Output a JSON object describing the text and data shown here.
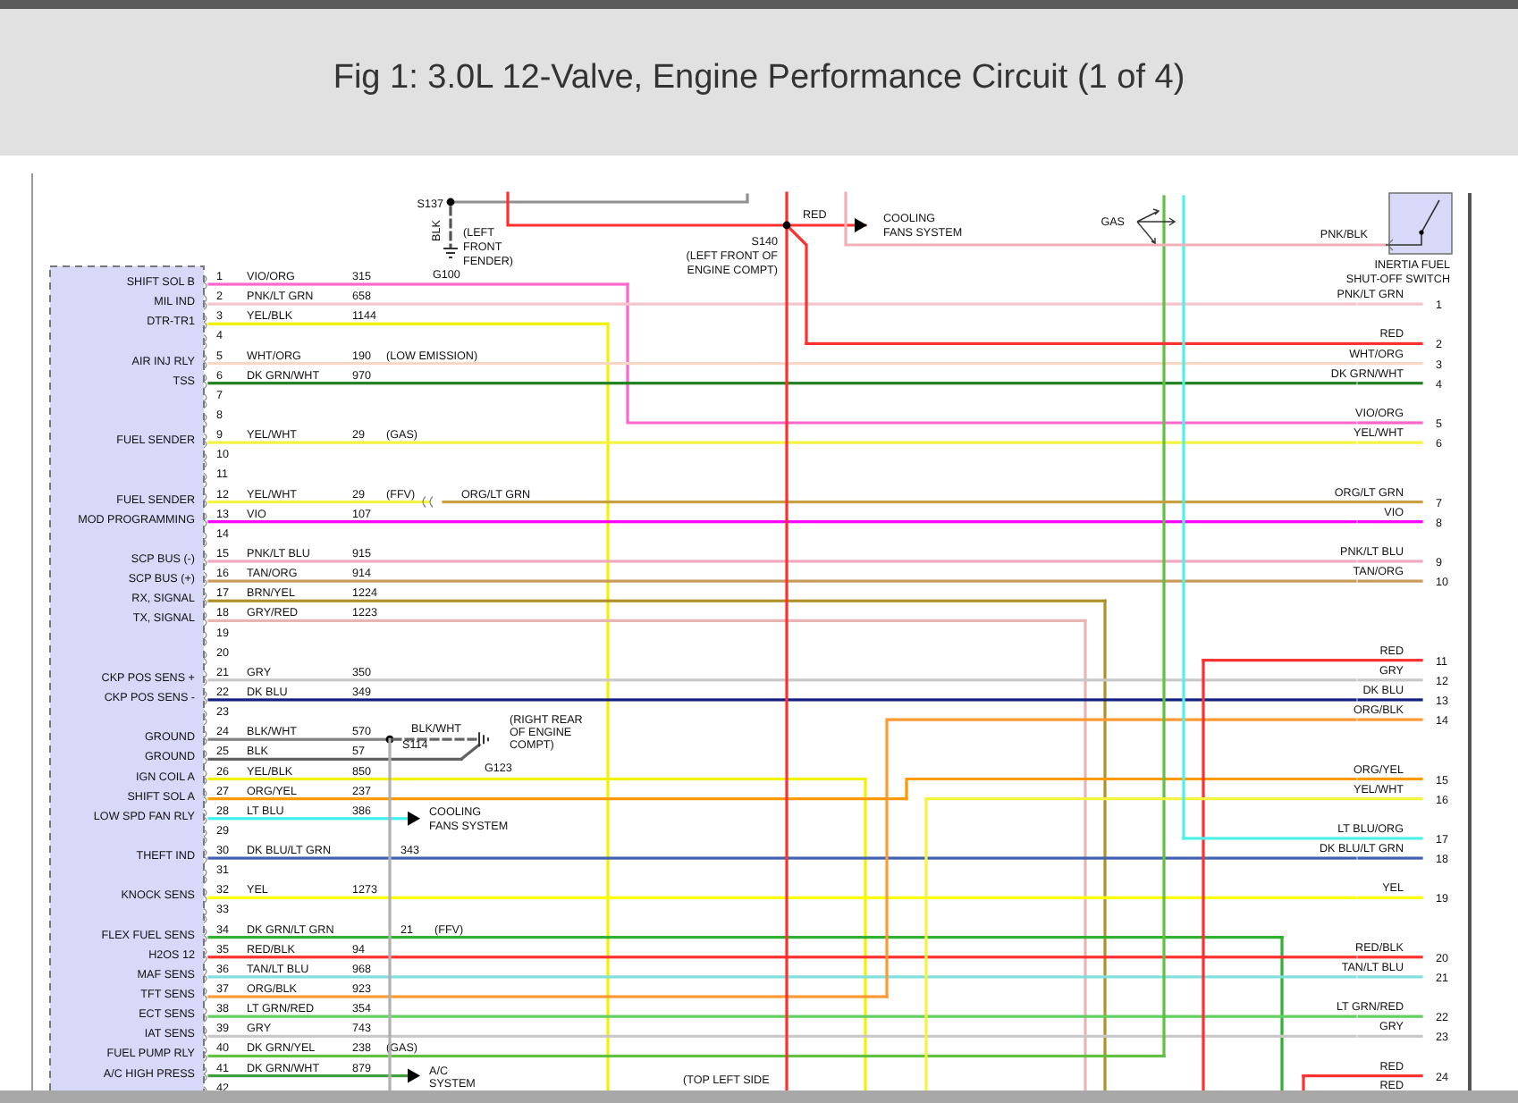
{
  "page": {
    "title": "Fig 1: 3.0L 12-Valve, Engine Performance Circuit (1 of 4)"
  },
  "diagram": {
    "left_connector": {
      "pins": [
        {
          "number": "1",
          "function": "SHIFT SOL B",
          "wire": "VIO/ORG",
          "circuit": "315",
          "color": "#ff66cc"
        },
        {
          "number": "2",
          "function": "MIL IND",
          "wire": "PNK/LT GRN",
          "circuit": "658",
          "color": "#f4c4cc"
        },
        {
          "number": "3",
          "function": "DTR-TR1",
          "wire": "YEL/BLK",
          "circuit": "1144",
          "color": "#f2f200"
        },
        {
          "number": "4"
        },
        {
          "number": "5",
          "function": "AIR INJ RLY",
          "wire": "WHT/ORG",
          "circuit": "190",
          "note": "(LOW EMISSION)",
          "color": "#f8d8c4"
        },
        {
          "number": "6",
          "function": "TSS",
          "wire": "DK GRN/WHT",
          "circuit": "970",
          "color": "#208020"
        },
        {
          "number": "7"
        },
        {
          "number": "8"
        },
        {
          "number": "9",
          "function": "FUEL SENDER",
          "wire": "YEL/WHT",
          "circuit": "29",
          "note": "(GAS)",
          "color": "#f4f440"
        },
        {
          "number": "10"
        },
        {
          "number": "11"
        },
        {
          "number": "12",
          "function": "FUEL SENDER",
          "wire": "YEL/WHT",
          "circuit": "29",
          "note": "(FFV)",
          "color": "#f4f440"
        },
        {
          "number": "13",
          "function": "MOD PROGRAMMING",
          "wire": "VIO",
          "circuit": "107",
          "color": "#ff00ff"
        },
        {
          "number": "14"
        },
        {
          "number": "15",
          "function": "SCP BUS (-)",
          "wire": "PNK/LT BLU",
          "circuit": "915",
          "color": "#f0a8c0"
        },
        {
          "number": "16",
          "function": "SCP BUS (+)",
          "wire": "TAN/ORG",
          "circuit": "914",
          "color": "#c89a5a"
        },
        {
          "number": "17",
          "function": "RX, SIGNAL",
          "wire": "BRN/YEL",
          "circuit": "1224",
          "color": "#b09028"
        },
        {
          "number": "18",
          "function": "TX, SIGNAL",
          "wire": "GRY/RED",
          "circuit": "1223",
          "color": "#e8b4b4"
        },
        {
          "number": "19"
        },
        {
          "number": "20"
        },
        {
          "number": "21",
          "function": "CKP POS SENS +",
          "wire": "GRY",
          "circuit": "350",
          "color": "#c8c8c8"
        },
        {
          "number": "22",
          "function": "CKP POS SENS -",
          "wire": "DK BLU",
          "circuit": "349",
          "color": "#102080"
        },
        {
          "number": "23"
        },
        {
          "number": "24",
          "function": "GROUND",
          "wire": "BLK/WHT",
          "circuit": "570",
          "color": "#808080"
        },
        {
          "number": "25",
          "function": "GROUND",
          "wire": "BLK",
          "circuit": "57",
          "color": "#606060"
        },
        {
          "number": "26",
          "function": "IGN COIL A",
          "wire": "YEL/BLK",
          "circuit": "850",
          "color": "#f2f200"
        },
        {
          "number": "27",
          "function": "SHIFT SOL A",
          "wire": "ORG/YEL",
          "circuit": "237",
          "color": "#ff9900"
        },
        {
          "number": "28",
          "function": "LOW SPD FAN RLY",
          "wire": "LT BLU",
          "circuit": "386",
          "color": "#40f0f0"
        },
        {
          "number": "29"
        },
        {
          "number": "30",
          "function": "THEFT IND",
          "wire": "DK BLU/LT GRN",
          "circuit": "343",
          "color": "#4060b0"
        },
        {
          "number": "31"
        },
        {
          "number": "32",
          "function": "KNOCK SENS",
          "wire": "YEL",
          "circuit": "1273",
          "color": "#ffff00"
        },
        {
          "number": "33"
        },
        {
          "number": "34",
          "function": "FLEX FUEL SENS",
          "wire": "DK GRN/LT GRN",
          "circuit": "21",
          "note": "(FFV)",
          "color": "#30b030"
        },
        {
          "number": "35",
          "function": "H2OS 12",
          "wire": "RED/BLK",
          "circuit": "94",
          "color": "#ff3030"
        },
        {
          "number": "36",
          "function": "MAF SENS",
          "wire": "TAN/LT BLU",
          "circuit": "968",
          "color": "#80e0e0"
        },
        {
          "number": "37",
          "function": "TFT SENS",
          "wire": "ORG/BLK",
          "circuit": "923",
          "color": "#ff9933"
        },
        {
          "number": "38",
          "function": "ECT SENS",
          "wire": "LT GRN/RED",
          "circuit": "354",
          "color": "#60d060"
        },
        {
          "number": "39",
          "function": "IAT SENS",
          "wire": "GRY",
          "circuit": "743",
          "color": "#c8c8c8"
        },
        {
          "number": "40",
          "function": "FUEL PUMP RLY",
          "wire": "DK GRN/YEL",
          "circuit": "238",
          "note": "(GAS)",
          "color": "#60c040"
        },
        {
          "number": "41",
          "function": "A/C HIGH PRESS",
          "wire": "DK GRN/WHT",
          "circuit": "879",
          "color": "#40a040"
        },
        {
          "number": "42"
        }
      ]
    },
    "right_connector": {
      "pins": [
        {
          "number": "1",
          "wire": "PNK/LT GRN",
          "color": "#f4c4cc"
        },
        {
          "number": "2",
          "wire": "RED",
          "color": "#ff3030"
        },
        {
          "number": "3",
          "wire": "WHT/ORG",
          "color": "#f8d8c4"
        },
        {
          "number": "4",
          "wire": "DK GRN/WHT",
          "color": "#208020"
        },
        {
          "number": "5",
          "wire": "VIO/ORG",
          "color": "#ff66cc"
        },
        {
          "number": "6",
          "wire": "YEL/WHT",
          "color": "#f4f440"
        },
        {
          "number": "7",
          "wire": "ORG/LT GRN",
          "color": "#c8a040"
        },
        {
          "number": "8",
          "wire": "VIO",
          "color": "#ff00ff"
        },
        {
          "number": "9",
          "wire": "PNK/LT BLU",
          "color": "#f0a8c0"
        },
        {
          "number": "10",
          "wire": "TAN/ORG",
          "color": "#c89a5a"
        },
        {
          "number": "11",
          "wire": "RED",
          "color": "#ff3030"
        },
        {
          "number": "12",
          "wire": "GRY",
          "color": "#c8c8c8"
        },
        {
          "number": "13",
          "wire": "DK BLU",
          "color": "#102080"
        },
        {
          "number": "14",
          "wire": "ORG/BLK",
          "color": "#ff9933"
        },
        {
          "number": "15",
          "wire": "ORG/YEL",
          "color": "#ff9900"
        },
        {
          "number": "16",
          "wire": "YEL/WHT",
          "color": "#f4f440"
        },
        {
          "number": "17",
          "wire": "LT BLU/ORG",
          "color": "#50f0e8"
        },
        {
          "number": "18",
          "wire": "DK BLU/LT GRN",
          "color": "#4060b0"
        },
        {
          "number": "19",
          "wire": "YEL",
          "color": "#ffff00"
        },
        {
          "number": "20",
          "wire": "RED/BLK",
          "color": "#ff3030"
        },
        {
          "number": "21",
          "wire": "TAN/LT BLU",
          "color": "#80e0e0"
        },
        {
          "number": "22",
          "wire": "LT GRN/RED",
          "color": "#60d060"
        },
        {
          "number": "23",
          "wire": "GRY",
          "color": "#c8c8c8"
        },
        {
          "number": "24",
          "wire": "RED",
          "color": "#ff3030"
        }
      ]
    },
    "callouts": [
      {
        "lines": [
          "S137"
        ]
      },
      {
        "lines": [
          "BLK"
        ]
      },
      {
        "lines": [
          "(LEFT",
          "FRONT",
          "FENDER)"
        ]
      },
      {
        "lines": [
          "G100"
        ]
      },
      {
        "lines": [
          "RED"
        ]
      },
      {
        "lines": [
          "S140",
          "(LEFT FRONT OF",
          "ENGINE COMPT)"
        ]
      },
      {
        "lines": [
          "COOLING",
          "FANS SYSTEM"
        ]
      },
      {
        "lines": [
          "GAS"
        ]
      },
      {
        "lines": [
          "PNK/BLK"
        ]
      },
      {
        "lines": [
          "INERTIA FUEL",
          "SHUT-OFF SWITCH"
        ]
      },
      {
        "lines": [
          "ORG/LT GRN"
        ]
      },
      {
        "lines": [
          "BLK/WHT"
        ]
      },
      {
        "lines": [
          "S114"
        ]
      },
      {
        "lines": [
          "(RIGHT REAR",
          "OF ENGINE",
          "COMPT)"
        ]
      },
      {
        "lines": [
          "G123"
        ]
      },
      {
        "lines": [
          "COOLING",
          "FANS SYSTEM"
        ]
      },
      {
        "lines": [
          "A/C",
          "SYSTEM"
        ]
      },
      {
        "lines": [
          "(TOP LEFT SIDE"
        ]
      },
      {
        "lines": [
          "RED"
        ]
      }
    ]
  }
}
